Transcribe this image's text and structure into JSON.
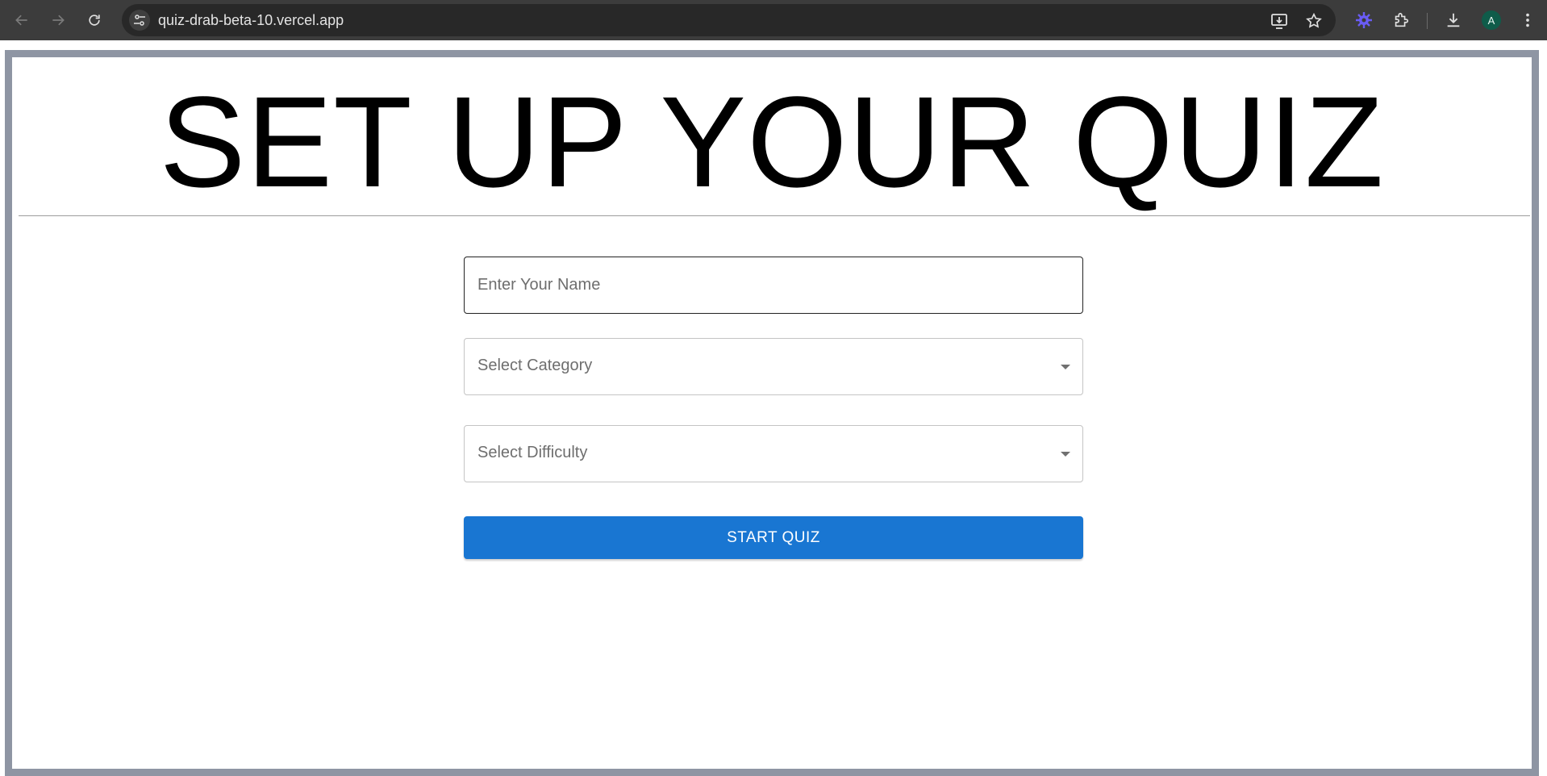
{
  "browser": {
    "url": "quiz-drab-beta-10.vercel.app",
    "profile_initial": "A",
    "icons": {
      "back": "arrow-left-icon",
      "forward": "arrow-right-icon",
      "reload": "reload-icon",
      "site_info": "tune-icon",
      "install": "install-app-icon",
      "bookmark": "star-icon",
      "extension_active": "purple-gear-icon",
      "extensions": "puzzle-icon",
      "download": "download-icon",
      "menu": "kebab-menu-icon"
    },
    "accent_colors": {
      "chrome_bg": "#3c3c3c",
      "omnibox_bg": "#282828",
      "avatar_bg": "#0f5c4a"
    }
  },
  "page": {
    "title": "SET UP YOUR QUIZ",
    "form": {
      "name_placeholder": "Enter Your Name",
      "category_placeholder": "Select Category",
      "difficulty_placeholder": "Select Difficulty",
      "start_label": "START QUIZ"
    },
    "colors": {
      "button": "#1976d2",
      "frame_border": "#8e95a3"
    }
  }
}
